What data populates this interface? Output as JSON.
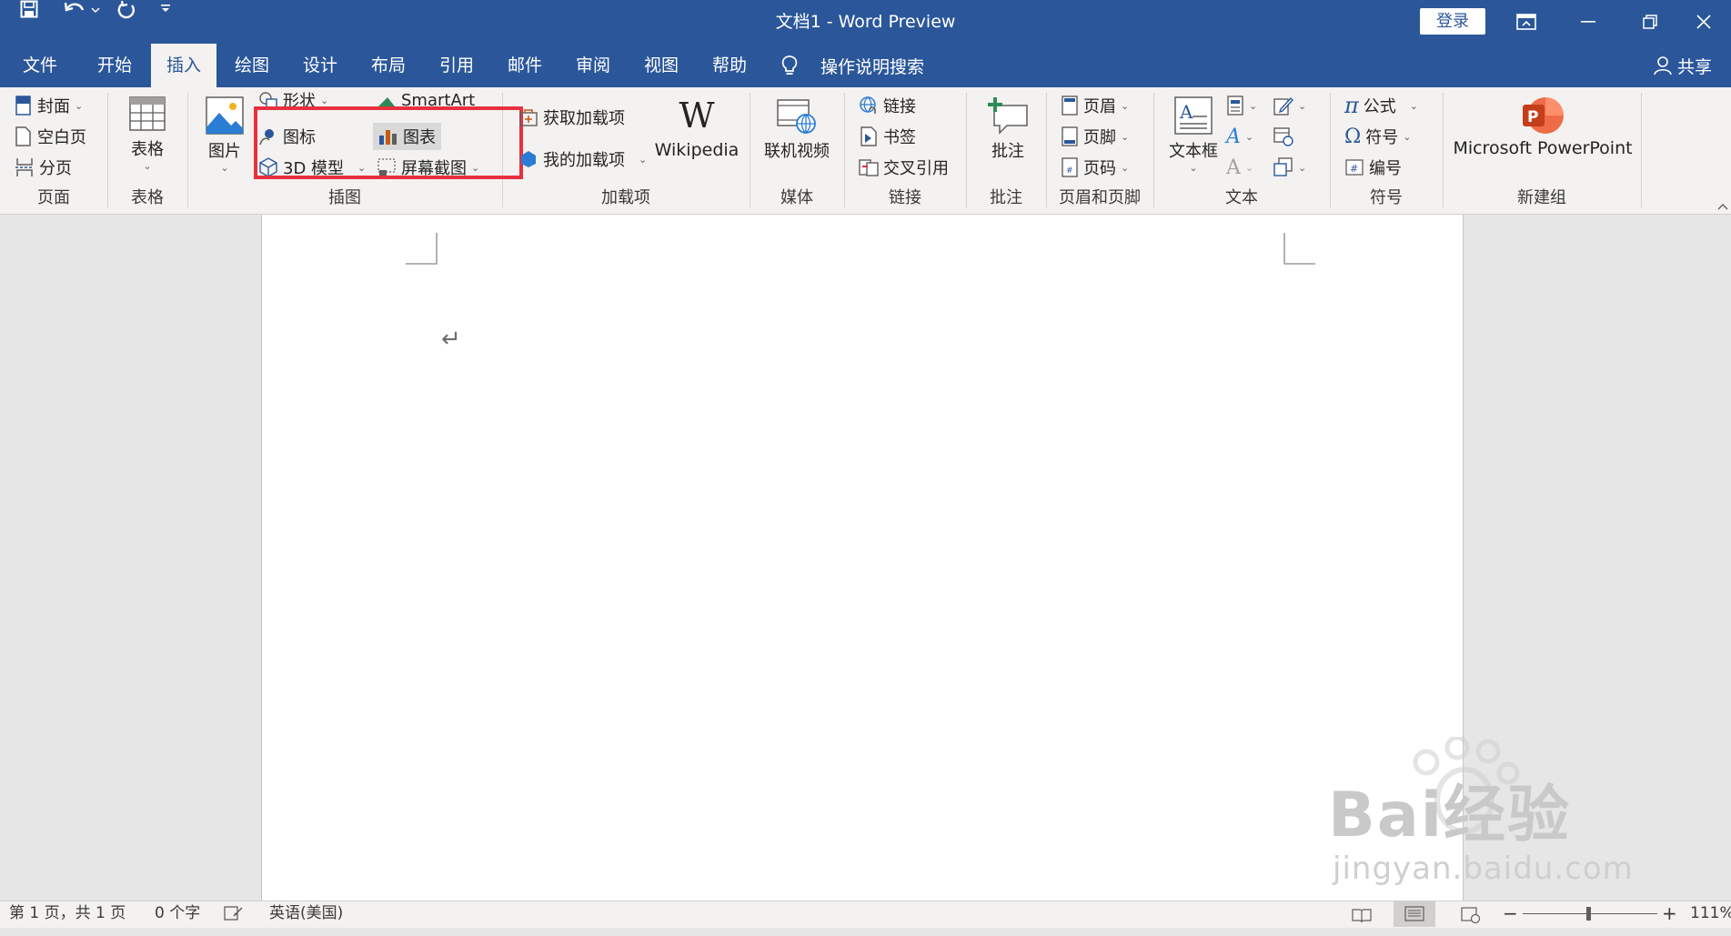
{
  "window": {
    "title": "文档1  -  Word Preview",
    "login_label": "登录"
  },
  "tabs": [
    "文件",
    "开始",
    "插入",
    "绘图",
    "设计",
    "布局",
    "引用",
    "邮件",
    "审阅",
    "视图",
    "帮助"
  ],
  "active_tab": "插入",
  "tell_me": "操作说明搜索",
  "share": "共享",
  "ribbon": {
    "pages": {
      "cover": "封面",
      "blank": "空白页",
      "break": "分页",
      "label": "页面"
    },
    "tables": {
      "table": "表格",
      "label": "表格"
    },
    "illustrations": {
      "pictures": "图片",
      "shapes": "形状",
      "smartart": "SmartArt",
      "icons": "图标",
      "chart": "图表",
      "models3d": "3D 模型",
      "screenshot": "屏幕截图",
      "label": "插图"
    },
    "addins": {
      "get": "获取加载项",
      "my": "我的加载项",
      "wikipedia": "Wikipedia",
      "label": "加载项"
    },
    "media": {
      "video": "联机视频",
      "label": "媒体"
    },
    "links": {
      "link": "链接",
      "bookmark": "书签",
      "crossref": "交叉引用",
      "label": "链接"
    },
    "comments": {
      "comment": "批注",
      "label": "批注"
    },
    "header_footer": {
      "header": "页眉",
      "footer": "页脚",
      "page_number": "页码",
      "label": "页眉和页脚"
    },
    "text": {
      "textbox": "文本框",
      "label": "文本"
    },
    "symbols": {
      "equation": "公式",
      "symbol": "符号",
      "number": "编号",
      "label": "符号"
    },
    "new_group": {
      "powerpoint": "Microsoft PowerPoint",
      "label": "新建组"
    }
  },
  "status": {
    "page": "第 1 页，共 1 页",
    "words": "0 个字",
    "language": "英语(美国)",
    "zoom": "111%",
    "zoom_minus": "−",
    "zoom_plus": "+"
  },
  "watermark": {
    "main": "Bai经验",
    "sub": "jingyan.baidu.com"
  },
  "colors": {
    "brand": "#2b579a",
    "highlight_box": "#e8303f",
    "ribbon_bg": "#f3f2f1"
  }
}
